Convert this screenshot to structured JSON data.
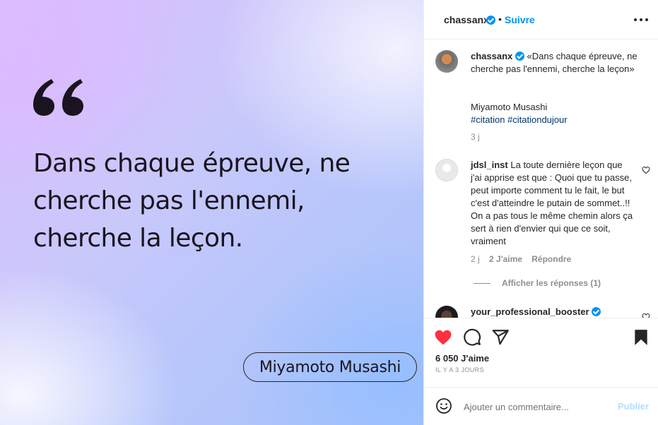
{
  "post": {
    "quote_lines": [
      "Dans chaque épreuve, ne",
      "cherche pas l'ennemi,",
      "cherche la leçon."
    ],
    "author": "Miyamoto Musashi"
  },
  "header": {
    "username": "chassanx",
    "separator": "•",
    "follow_label": "Suivre"
  },
  "caption": {
    "username": "chassanx",
    "text": "«Dans chaque épreuve, ne cherche pas l'ennemi, cherche la leçon»",
    "author": "Miyamoto Musashi",
    "hashtags": "#citation #citationdujour",
    "time": "3 j"
  },
  "comments": [
    {
      "username": "jdsl_inst",
      "text": "La toute dernière leçon que j'ai apprise est que : Quoi que tu passe, peut importe comment tu le fait, le but c'est d'atteindre le putain de sommet..!! On a pas tous le même chemin alors ça sert à rien d'envier qui que ce soit, vraiment",
      "time": "2 j",
      "likes": "2 J'aime",
      "reply_label": "Répondre",
      "view_replies": "Afficher les réponses (1)"
    },
    {
      "username": "your_professional_booster",
      "verified": true
    }
  ],
  "actions": {
    "likes": "6 050 J'aime",
    "time": "IL Y A 3 JOURS",
    "like_icon": "heart-filled-icon",
    "comment_icon": "comment-bubble-icon",
    "share_icon": "paper-plane-icon",
    "save_icon": "bookmark-icon"
  },
  "add_comment": {
    "placeholder": "Ajouter un commentaire...",
    "publish_label": "Publier"
  },
  "colors": {
    "accent": "#0095f6",
    "like_red": "#ff3040",
    "muted": "#8e8e8e"
  }
}
